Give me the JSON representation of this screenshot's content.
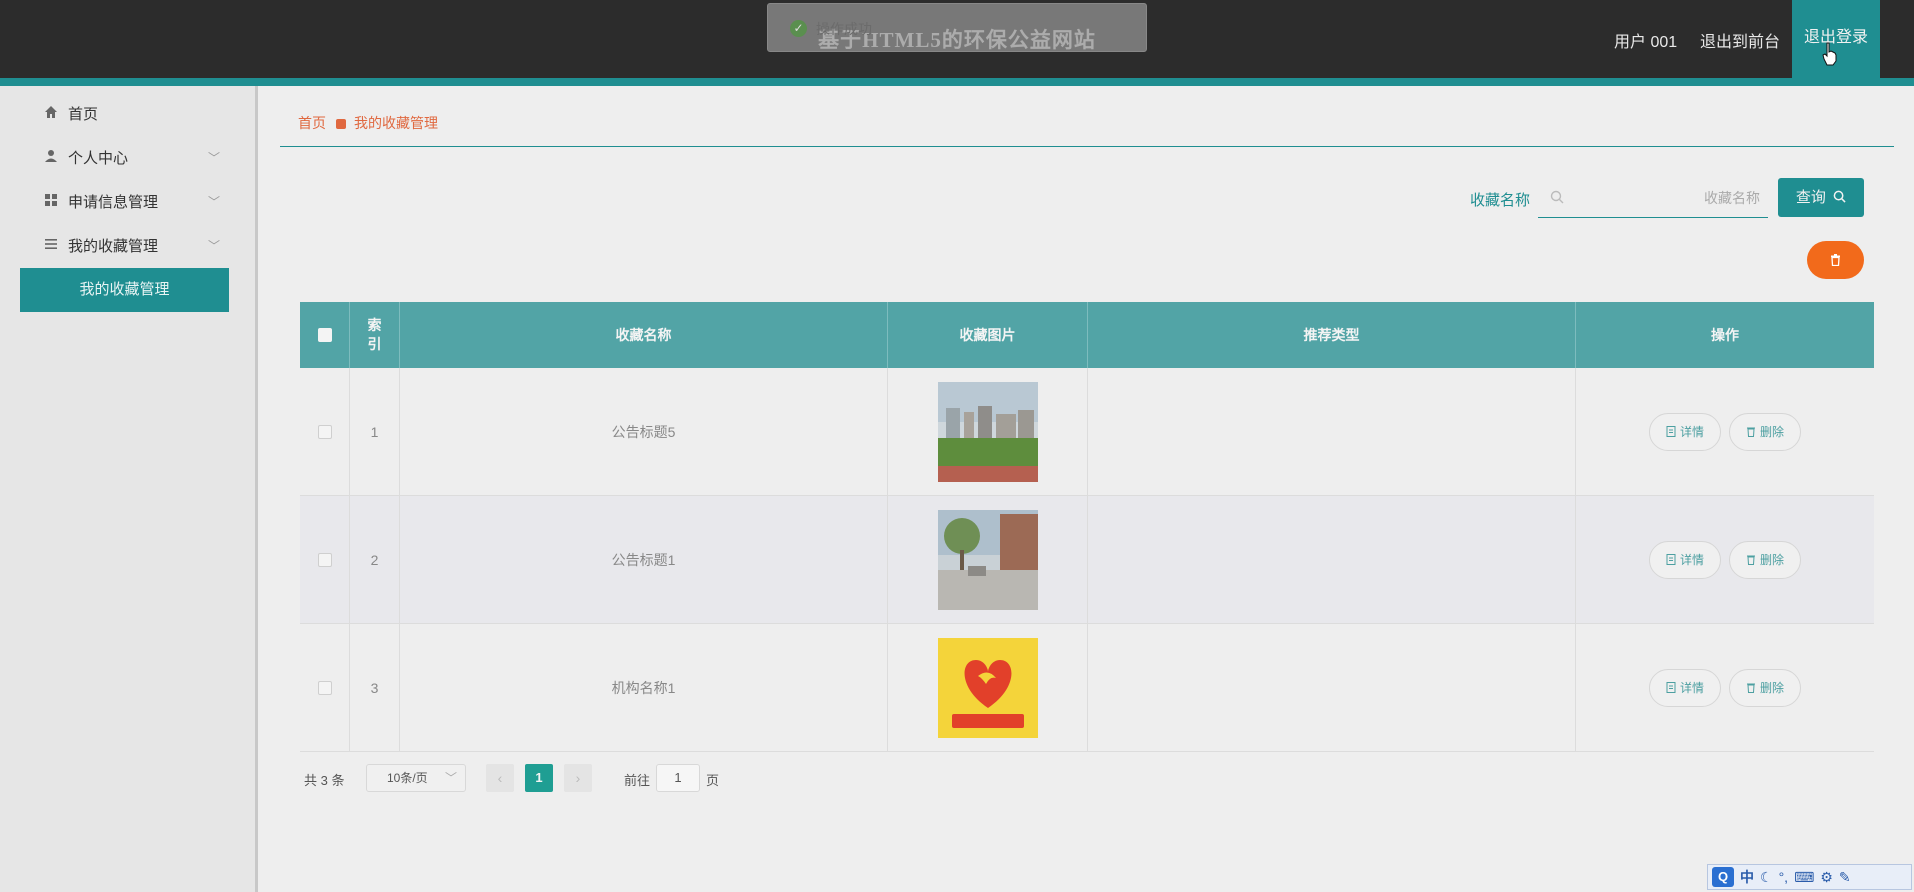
{
  "header": {
    "site_title": "基于HTML5的环保公益网站",
    "toast_text": "操作成功",
    "user_label": "用户 001",
    "back_front": "退出到前台",
    "logout": "退出登录"
  },
  "sidebar": {
    "items": [
      {
        "label": "首页",
        "icon": "home-icon"
      },
      {
        "label": "个人中心",
        "icon": "user-icon"
      },
      {
        "label": "申请信息管理",
        "icon": "grid-icon"
      },
      {
        "label": "我的收藏管理",
        "icon": "list-icon"
      }
    ],
    "active_sub": "我的收藏管理"
  },
  "breadcrumb": {
    "home": "首页",
    "current": "我的收藏管理"
  },
  "search": {
    "label": "收藏名称",
    "placeholder": "收藏名称",
    "button": "查询"
  },
  "table": {
    "headers": [
      "索引",
      "收藏名称",
      "收藏图片",
      "推荐类型",
      "操作"
    ],
    "rows": [
      {
        "index": "1",
        "name": "公告标题5",
        "type": "",
        "image": "campus-photo"
      },
      {
        "index": "2",
        "name": "公告标题1",
        "type": "",
        "image": "plaza-photo"
      },
      {
        "index": "3",
        "name": "机构名称1",
        "type": "",
        "image": "sunshine-volunteer-logo"
      }
    ],
    "detail_label": "详情",
    "delete_label": "删除"
  },
  "pagination": {
    "total": "共 3 条",
    "page_size": "10条/页",
    "current_page": "1",
    "goto_label": "前往",
    "goto_value": "1",
    "page_suffix": "页"
  },
  "ime": {
    "lang": "中"
  },
  "colors": {
    "accent": "#1f8e91",
    "header_bg": "#2c2c2c",
    "danger": "#f26a1b",
    "breadcrumb": "#e0683f"
  }
}
